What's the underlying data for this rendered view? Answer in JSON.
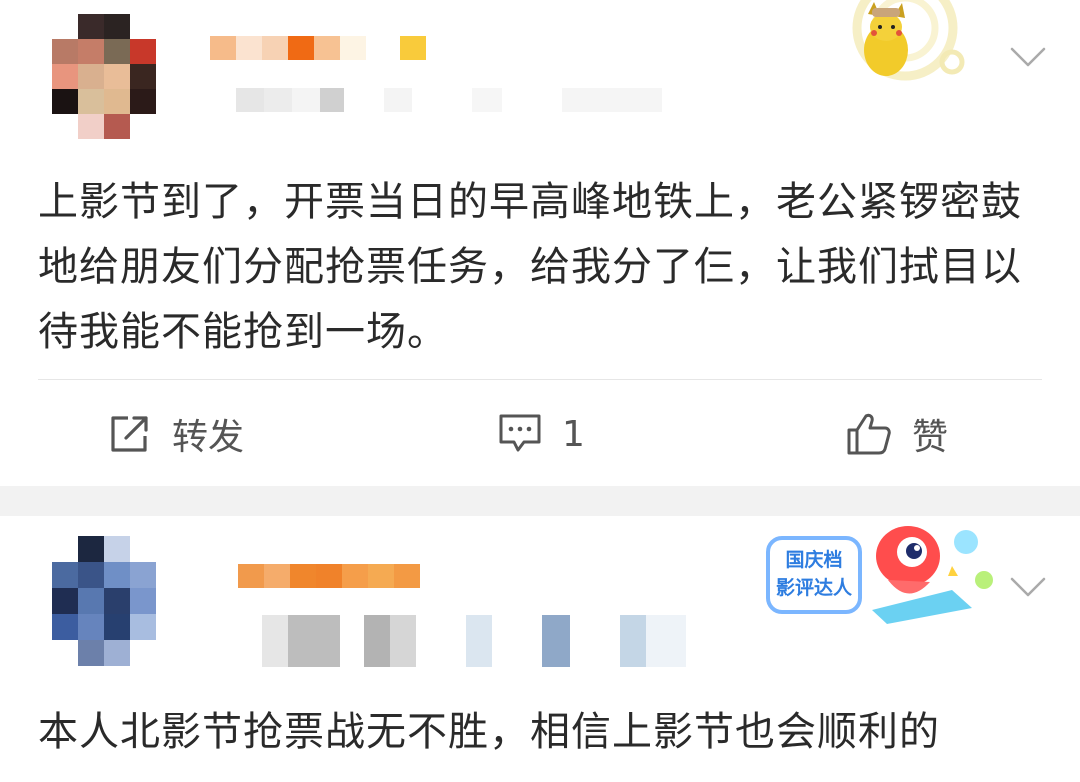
{
  "posts": [
    {
      "text": "上影节到了，开票当日的早高峰地铁上，老公紧锣密鼓地给朋友们分配抢票任务，给我分了仨，让我们拭目以待我能不能抢到一场。",
      "actions": {
        "repost_label": "转发",
        "comment_count": "1",
        "like_label": "赞"
      }
    },
    {
      "text": "本人北影节抢票战无不胜，相信上影节也会顺利的",
      "badge": {
        "line1": "国庆档",
        "line2": "影评达人"
      }
    }
  ],
  "icons": {
    "repost": "share-square-icon",
    "comment": "comment-bubble-icon",
    "like": "thumbs-up-icon",
    "more": "chevron-down-icon"
  },
  "colors": {
    "text": "#2a2a2a",
    "action_text": "#555555",
    "page_bg": "#f2f2f2",
    "card_bg": "#ffffff",
    "username_orange": "#f08a2c"
  }
}
